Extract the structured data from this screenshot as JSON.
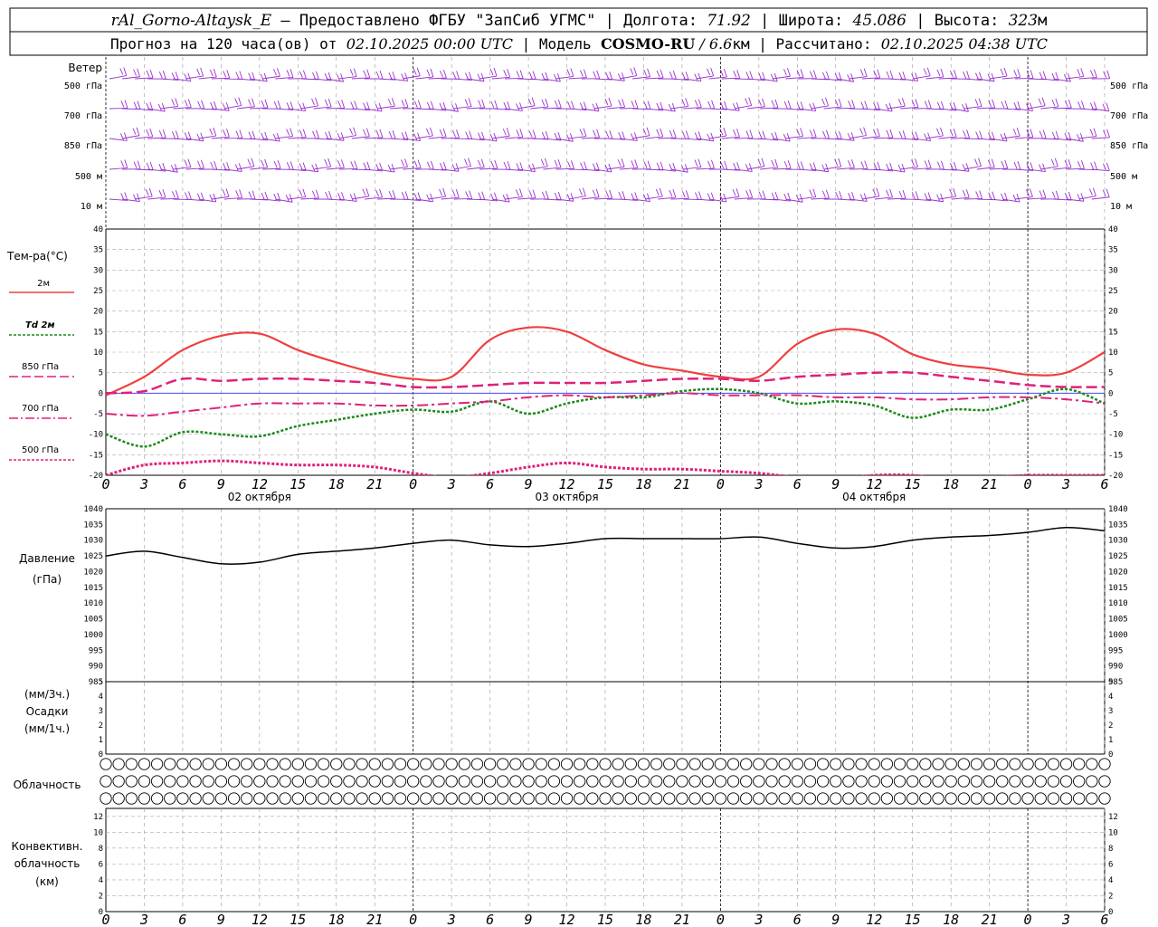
{
  "header": {
    "station": "rAl_Gorno-Altaysk_E",
    "provider": " – Предоставлено ФГБУ \"ЗапСиб УГМС\"",
    "lon_label": "Долгота:",
    "lon": "71.92",
    "lat_label": "Широта:",
    "lat": "45.086",
    "alt_label": "Высота:",
    "alt": "323",
    "alt_unit": "м",
    "forecast_label": "Прогноз на 120 часа(ов)  от",
    "forecast_start": "02.10.2025 00:00 UTC",
    "model_label": "Модель",
    "model": "COSMO-RU",
    "model_res": " / 6.6",
    "model_res_unit": "км",
    "computed_label": "Рассчитано:",
    "computed": "02.10.2025 04:38 UTC"
  },
  "panel_labels": {
    "wind": "Ветер",
    "temp": "Тем-ра(°С)",
    "temp_2m": "2м",
    "td_2m": "Td  2м",
    "t850": "850 гПа",
    "t700": "700 гПа",
    "t500": "500 гПа",
    "pressure_1": "Давление",
    "pressure_2": "(гПа)",
    "precip_1": "(мм/3ч.)",
    "precip_2": "Осадки",
    "precip_3": "(мм/1ч.)",
    "cloud": "Облачность",
    "conv_1": "Конвективн.",
    "conv_2": "облачность",
    "conv_3": "(км)"
  },
  "wind_levels": [
    "500 гПа",
    "700 гПа",
    "850 гПа",
    "500 м",
    "10  м"
  ],
  "x_hour_labels": [
    "0",
    "3",
    "6",
    "9",
    "12",
    "15",
    "18",
    "21",
    "0",
    "3",
    "6",
    "9",
    "12",
    "15",
    "18",
    "21",
    "0",
    "3",
    "6",
    "9",
    "12",
    "15",
    "18",
    "21",
    "0",
    "3",
    "6"
  ],
  "day_labels": [
    "02 октября",
    "03 октября",
    "04 октября"
  ],
  "colors": {
    "wind": "#9932cc",
    "t2m": "#ee4040",
    "td2m": "#1a8a1a",
    "t850": "#e0207a",
    "t700": "#e0207a",
    "t500": "#e0207a",
    "zero_line": "#3030ff",
    "pressure": "#000000"
  },
  "chart_data": [
    {
      "type": "line",
      "panel": "temperature",
      "ylim": [
        -20,
        40
      ],
      "yticks": [
        -20,
        -15,
        -10,
        -5,
        0,
        5,
        10,
        15,
        20,
        25,
        30,
        35,
        40
      ],
      "x_hours": [
        0,
        3,
        6,
        9,
        12,
        15,
        18,
        21,
        24,
        27,
        30,
        33,
        36,
        39,
        42,
        45,
        48,
        51,
        54,
        57,
        60,
        63,
        66,
        69,
        72,
        75,
        78
      ],
      "series": [
        {
          "name": "2м",
          "values": [
            -0.5,
            4,
            10.5,
            14,
            14.5,
            10.5,
            7.5,
            5,
            3.5,
            4,
            13,
            16,
            15,
            10.5,
            7,
            5.5,
            4,
            4,
            12,
            15.5,
            14.5,
            9.5,
            7,
            6,
            4.5,
            5,
            10
          ]
        },
        {
          "name": "Td  2м",
          "values": [
            -10,
            -13,
            -9.5,
            -10,
            -10.5,
            -8,
            -6.5,
            -5,
            -4,
            -4.5,
            -2,
            -5,
            -2.5,
            -1,
            -1,
            0.5,
            1,
            0,
            -2.5,
            -2,
            -3,
            -6,
            -4,
            -4,
            -1.5,
            1,
            -2.5
          ]
        },
        {
          "name": "850 гПа",
          "values": [
            0,
            0.5,
            3.5,
            3,
            3.5,
            3.5,
            3,
            2.5,
            1.5,
            1.5,
            2,
            2.5,
            2.5,
            2.5,
            3,
            3.5,
            3.5,
            3,
            4,
            4.5,
            5,
            5,
            4,
            3,
            2,
            1.5,
            1.5
          ]
        },
        {
          "name": "700 гПа",
          "values": [
            -5,
            -5.5,
            -4.5,
            -3.5,
            -2.5,
            -2.5,
            -2.5,
            -3,
            -3,
            -2.5,
            -2,
            -1,
            -0.5,
            -1,
            -0.5,
            0,
            -0.5,
            -0.5,
            -0.5,
            -1,
            -1,
            -1.5,
            -1.5,
            -1,
            -1,
            -1.5,
            -2.5
          ]
        },
        {
          "name": "500 гПа",
          "values": [
            -20,
            -17.5,
            -17,
            -16.5,
            -17,
            -17.5,
            -17.5,
            -18,
            -19.5,
            -20.5,
            -19.5,
            -18,
            -17,
            -18,
            -18.5,
            -18.5,
            -19,
            -19.5,
            -20.5,
            -21,
            -20,
            -20,
            -21,
            -20.5,
            -20,
            -20,
            -20
          ]
        }
      ]
    },
    {
      "type": "line",
      "panel": "pressure",
      "ylim": [
        985,
        1040
      ],
      "yticks": [
        985,
        990,
        995,
        1000,
        1005,
        1010,
        1015,
        1020,
        1025,
        1030,
        1035,
        1040
      ],
      "x_hours": [
        0,
        3,
        6,
        9,
        12,
        15,
        18,
        21,
        24,
        27,
        30,
        33,
        36,
        39,
        42,
        45,
        48,
        51,
        54,
        57,
        60,
        63,
        66,
        69,
        72,
        75,
        78
      ],
      "series": [
        {
          "name": "Давление",
          "values": [
            1025,
            1026.5,
            1024.5,
            1022.5,
            1023,
            1025.5,
            1026.5,
            1027.5,
            1029,
            1030,
            1028.5,
            1028,
            1029,
            1030.5,
            1030.5,
            1030.5,
            1030.5,
            1031,
            1029,
            1027.5,
            1028,
            1030,
            1031,
            1031.5,
            1032.5,
            1034,
            1033
          ]
        }
      ]
    },
    {
      "type": "bar",
      "panel": "precipitation",
      "ylim": [
        0,
        5
      ],
      "yticks": [
        0,
        1,
        2,
        3,
        4,
        5
      ],
      "sub_yticks": [
        0,
        1,
        2,
        3,
        4,
        5
      ],
      "values": []
    },
    {
      "type": "scatter",
      "panel": "cloudiness",
      "rows": 3,
      "cloud_cover_percent": [
        0,
        0,
        0,
        0,
        0,
        0,
        0,
        0,
        0,
        0,
        0,
        0,
        0,
        0,
        0,
        0,
        0,
        0,
        0,
        0,
        0,
        0,
        0,
        0,
        0,
        0,
        0,
        0,
        0,
        0,
        0,
        0,
        0,
        0,
        0,
        0,
        0,
        0,
        0,
        0,
        0,
        0,
        0,
        0,
        0,
        0,
        0,
        0,
        0,
        0,
        0,
        0,
        0,
        0,
        0,
        0,
        0,
        0,
        0,
        0,
        0,
        0,
        0,
        0,
        0,
        0,
        0,
        0,
        0,
        0,
        0,
        0,
        0,
        0,
        0,
        0,
        0,
        0,
        0
      ]
    },
    {
      "type": "bar",
      "panel": "convective_clouds",
      "ylim": [
        0,
        13
      ],
      "yticks": [
        0,
        2,
        4,
        6,
        8,
        10,
        12
      ],
      "values": []
    }
  ]
}
